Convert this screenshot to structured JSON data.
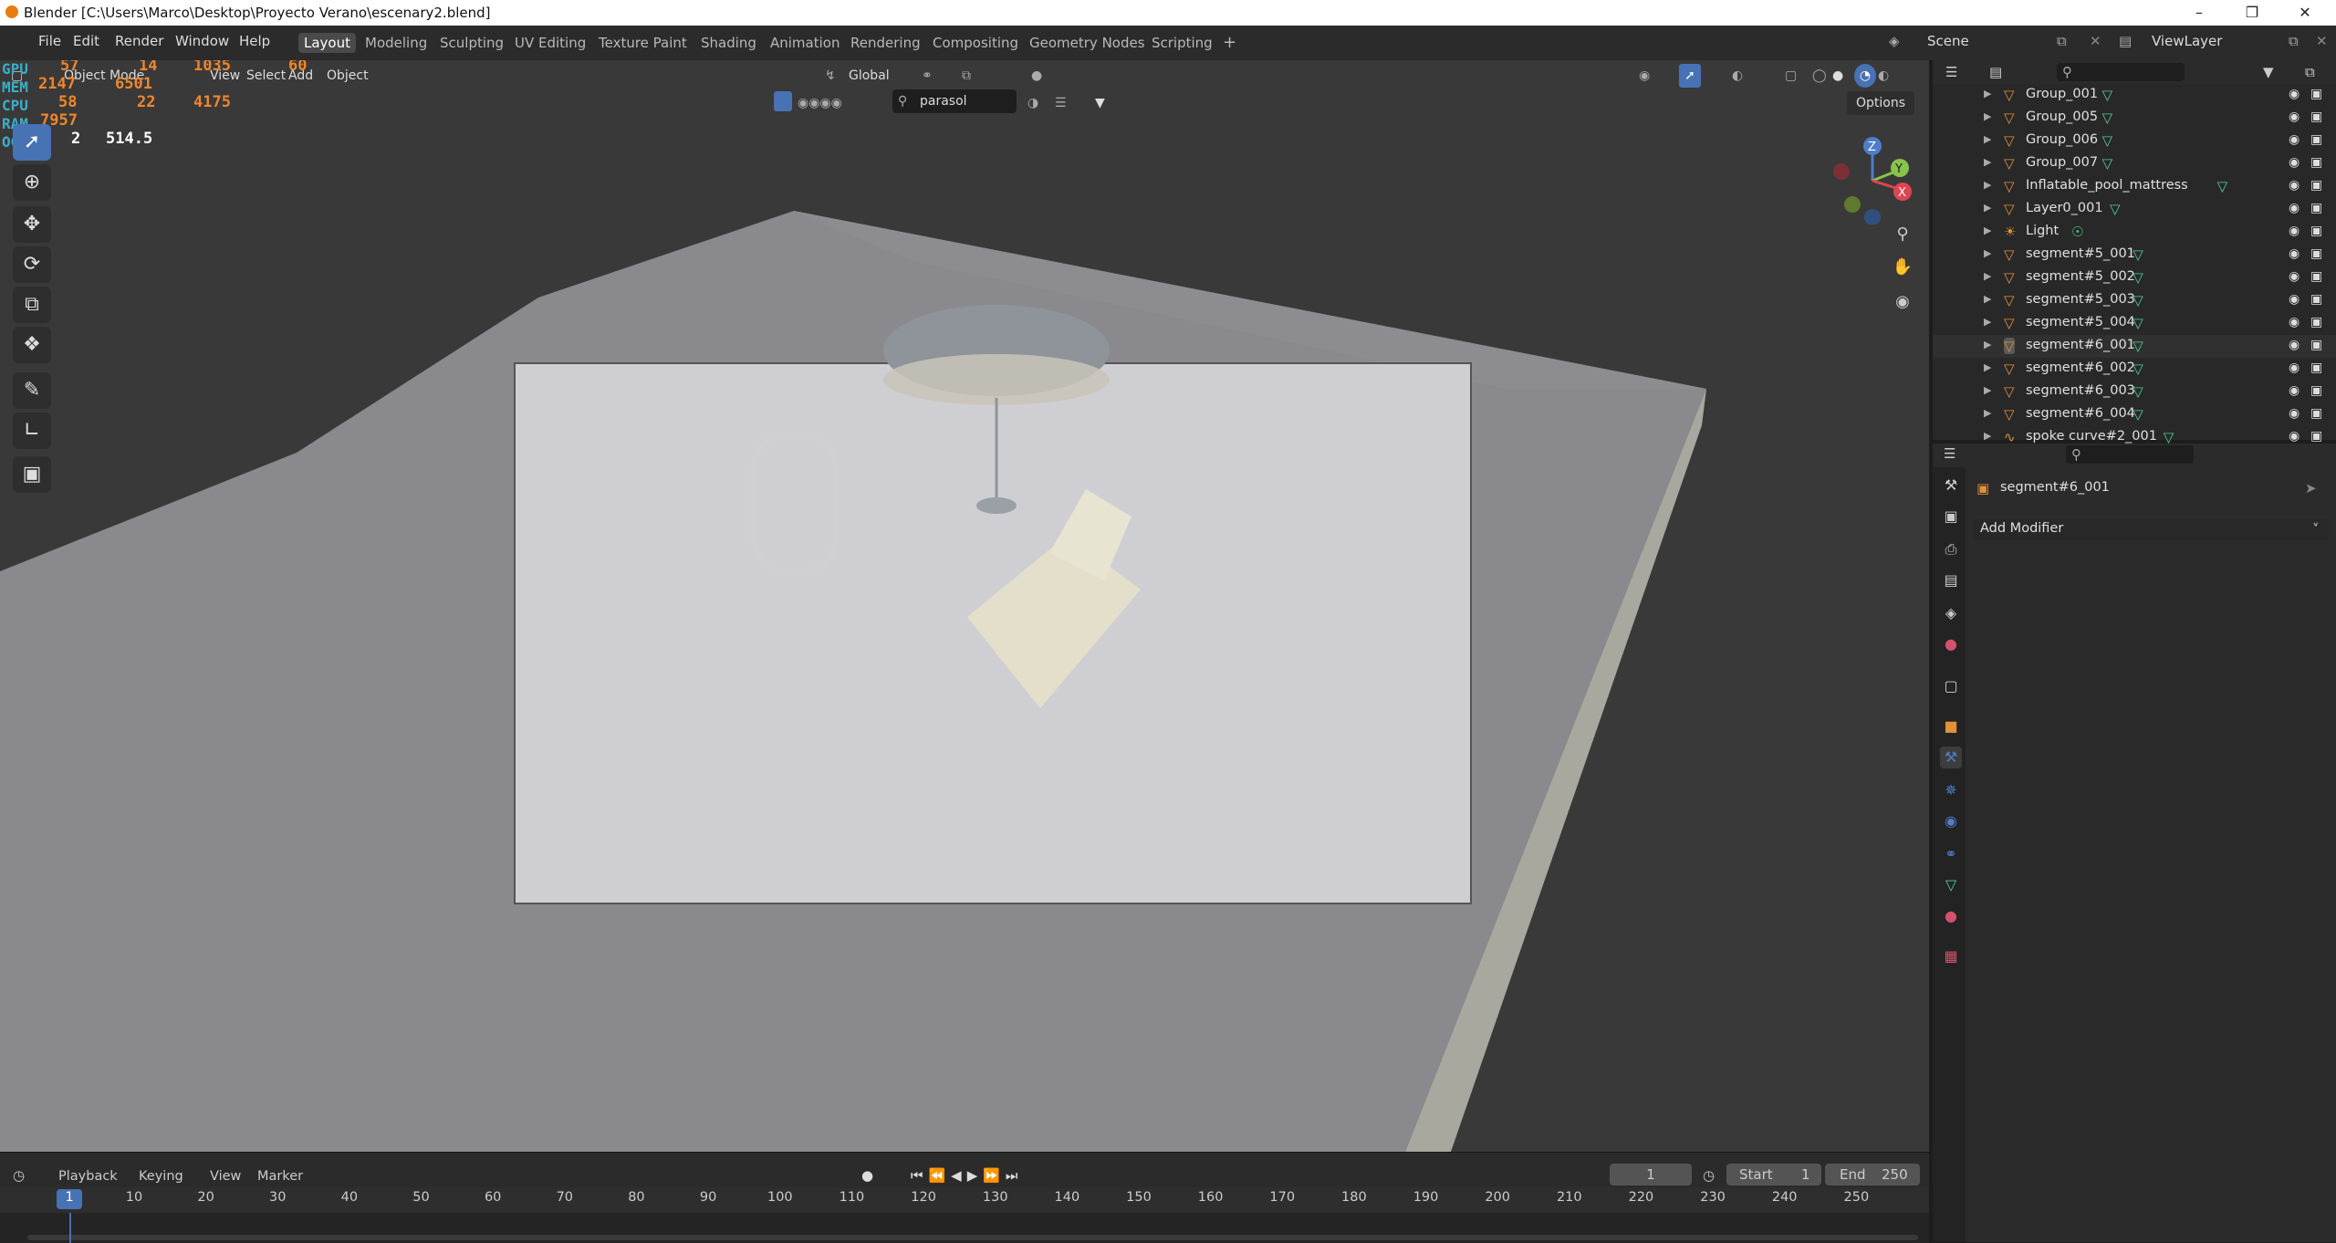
{
  "title_bar": {
    "title": "Blender [C:\\Users\\Marco\\Desktop\\Proyecto Verano\\escenary2.blend]"
  },
  "menus": [
    "File",
    "Edit",
    "Render",
    "Window",
    "Help"
  ],
  "workspaces": [
    "Layout",
    "Modeling",
    "Sculpting",
    "UV Editing",
    "Texture Paint",
    "Shading",
    "Animation",
    "Rendering",
    "Compositing",
    "Geometry Nodes",
    "Scripting"
  ],
  "scene": {
    "name": "Scene",
    "view_layer": "ViewLayer"
  },
  "viewport": {
    "mode": "Object Mode",
    "menus": [
      "View",
      "Select",
      "Add",
      "Object"
    ],
    "transform_orientation": "Global",
    "search_value": "parasol",
    "options_label": "Options"
  },
  "stats_overlay": {
    "labels": [
      "GPU",
      "MEM",
      "CPU",
      "RAM",
      "OGL"
    ],
    "values": [
      "57",
      "14",
      "1035",
      "60",
      "2147",
      "6501",
      "58",
      "22",
      "4175",
      "7957",
      "2",
      "514.5"
    ]
  },
  "outliner": {
    "items": [
      {
        "name": "Group_001",
        "type": "mesh"
      },
      {
        "name": "Group_005",
        "type": "mesh"
      },
      {
        "name": "Group_006",
        "type": "mesh"
      },
      {
        "name": "Group_007",
        "type": "mesh"
      },
      {
        "name": "Inflatable_pool_mattress",
        "type": "mesh"
      },
      {
        "name": "Layer0_001",
        "type": "mesh"
      },
      {
        "name": "Light",
        "type": "light"
      },
      {
        "name": "segment#5_001",
        "type": "mesh"
      },
      {
        "name": "segment#5_002",
        "type": "mesh"
      },
      {
        "name": "segment#5_003",
        "type": "mesh"
      },
      {
        "name": "segment#5_004",
        "type": "mesh"
      },
      {
        "name": "segment#6_001",
        "type": "mesh",
        "selected": true
      },
      {
        "name": "segment#6_002",
        "type": "mesh"
      },
      {
        "name": "segment#6_003",
        "type": "mesh"
      },
      {
        "name": "segment#6_004",
        "type": "mesh"
      },
      {
        "name": "spoke curve#2_001",
        "type": "curve"
      }
    ]
  },
  "properties": {
    "object_name": "segment#6_001",
    "add_modifier_label": "Add Modifier"
  },
  "timeline": {
    "menus": [
      "Playback",
      "Keying",
      "View",
      "Marker"
    ],
    "current_frame": "1",
    "start_label": "Start",
    "start_value": "1",
    "end_label": "End",
    "end_value": "250",
    "ticks": [
      "1",
      "10",
      "20",
      "30",
      "40",
      "50",
      "60",
      "70",
      "80",
      "90",
      "100",
      "110",
      "120",
      "130",
      "140",
      "150",
      "160",
      "170",
      "180",
      "190",
      "200",
      "210",
      "220",
      "230",
      "240",
      "250"
    ]
  },
  "colors": {
    "accent": "#4772b3",
    "active_tab": "#4a4a4a",
    "mesh_icon": "#e0913a",
    "data_icon": "#4fd18f",
    "stats": "#f0862c"
  }
}
